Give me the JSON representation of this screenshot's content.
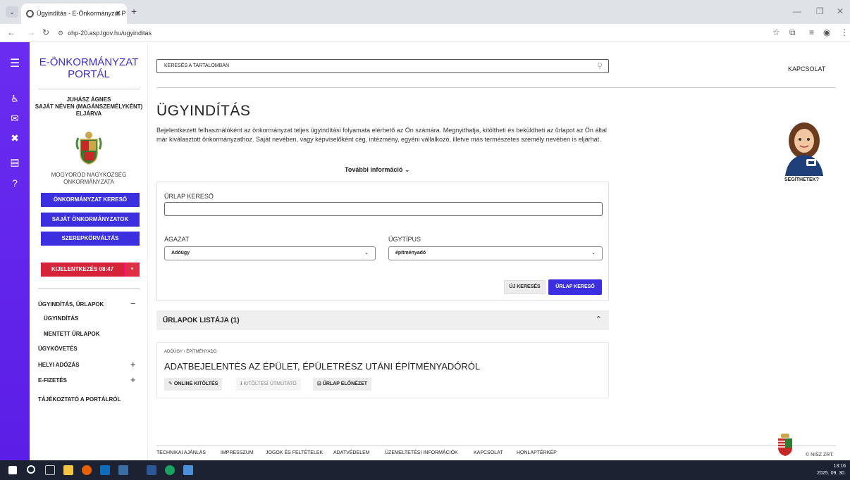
{
  "browser": {
    "tab_title": "Ügyindítás - E-Önkormányzat P",
    "tab_close": "✕",
    "new_tab": "+",
    "url": "ohp-20.asp.lgov.hu/ugyinditas"
  },
  "sidebar": {
    "portal_title_line1": "E-ÖNKORMÁNYZAT",
    "portal_title_line2": "PORTÁL",
    "user_line1": "JUHÁSZ ÁGNES",
    "user_line2": "SAJÁT NÉVEN (MAGÁNSZEMÉLYKÉNT)",
    "user_line3": "ELJÁRVA",
    "muni_line1": "MOGYORÓD NAGYKÖZSÉG",
    "muni_line2": "ÖNKORMÁNYZATA",
    "btn_kereso": "ÖNKORMÁNYZAT KERESŐ",
    "btn_sajat": "SAJÁT ÖNKORMÁNYZATOK",
    "btn_szerep": "SZEREPKÖRVÁLTÁS",
    "logout": "KIJELENTKEZÉS 08:47",
    "menu": {
      "ugyinditas_urlapok": "ÜGYINDÍTÁS, ŰRLAPOK",
      "ugyinditas": "ÜGYINDÍTÁS",
      "mentett": "MENTETT ŰRLAPOK",
      "ugykovetes": "ÜGYKÖVETÉS",
      "helyi": "HELYI ADÓZÁS",
      "efizetes": "E-FIZETÉS",
      "tajekoztato": "TÁJÉKOZTATÓ A PORTÁLRÓL"
    }
  },
  "header": {
    "search_placeholder": "KERESÉS A TARTALOMBAN",
    "kapcsolat": "KAPCSOLAT"
  },
  "main": {
    "title": "ÜGYINDÍTÁS",
    "intro": "Bejelentkezett felhasználóként az önkormányzat teljes ügyindítási folyamata elérhető az Ön számára. Megnyithatja, kitöltheti és beküldheti az űrlapot az Ön által már kiválasztott önkormányzathoz. Saját nevében, vagy képviselőként cég, intézmény, egyéni vállalkozó, illetve más természetes személy nevében is eljárhat.",
    "more_info": "További információ",
    "form": {
      "search_label": "ŰRLAP KERESŐ",
      "agazat_label": "ÁGAZAT",
      "agazat_value": "Adóügy",
      "ugytipus_label": "ÜGYTÍPUS",
      "ugytipus_value": "építményadó",
      "btn_new": "ÚJ KERESÉS",
      "btn_search": "ŰRLAP KERESŐ"
    },
    "list_title": "ŰRLAPOK LISTÁJA (1)",
    "result": {
      "breadcrumb": "ADÓÜGY › ÉPÍTMÉNYADÓ",
      "title": "ADATBEJELENTÉS AZ ÉPÜLET, ÉPÜLETRÉSZ UTÁNI ÉPÍTMÉNYADÓRÓL",
      "btn_online": "ONLINE KITÖLTÉS",
      "btn_guide": "KITÖLTÉSI ÚTMUTATÓ",
      "btn_preview": "ŰRLAP ELŐNÉZET"
    },
    "assistant_label": "SEGÍTHETEK?"
  },
  "footer": {
    "links": [
      "TECHNIKAI AJÁNLÁS",
      "IMPRESSZUM",
      "JOGOK ÉS FELTÉTELEK",
      "ADATVÉDELEM",
      "ÜZEMELTETÉSI INFORMÁCIÓK",
      "KAPCSOLAT",
      "HONLAPTÉRKÉP"
    ],
    "nisz": "© NISZ ZRT."
  },
  "taskbar": {
    "time": "13:16",
    "date": "2025. 09. 30."
  },
  "colors": {
    "accent": "#3b2fe0",
    "rail": "#5e17eb",
    "logout": "#d72339"
  }
}
